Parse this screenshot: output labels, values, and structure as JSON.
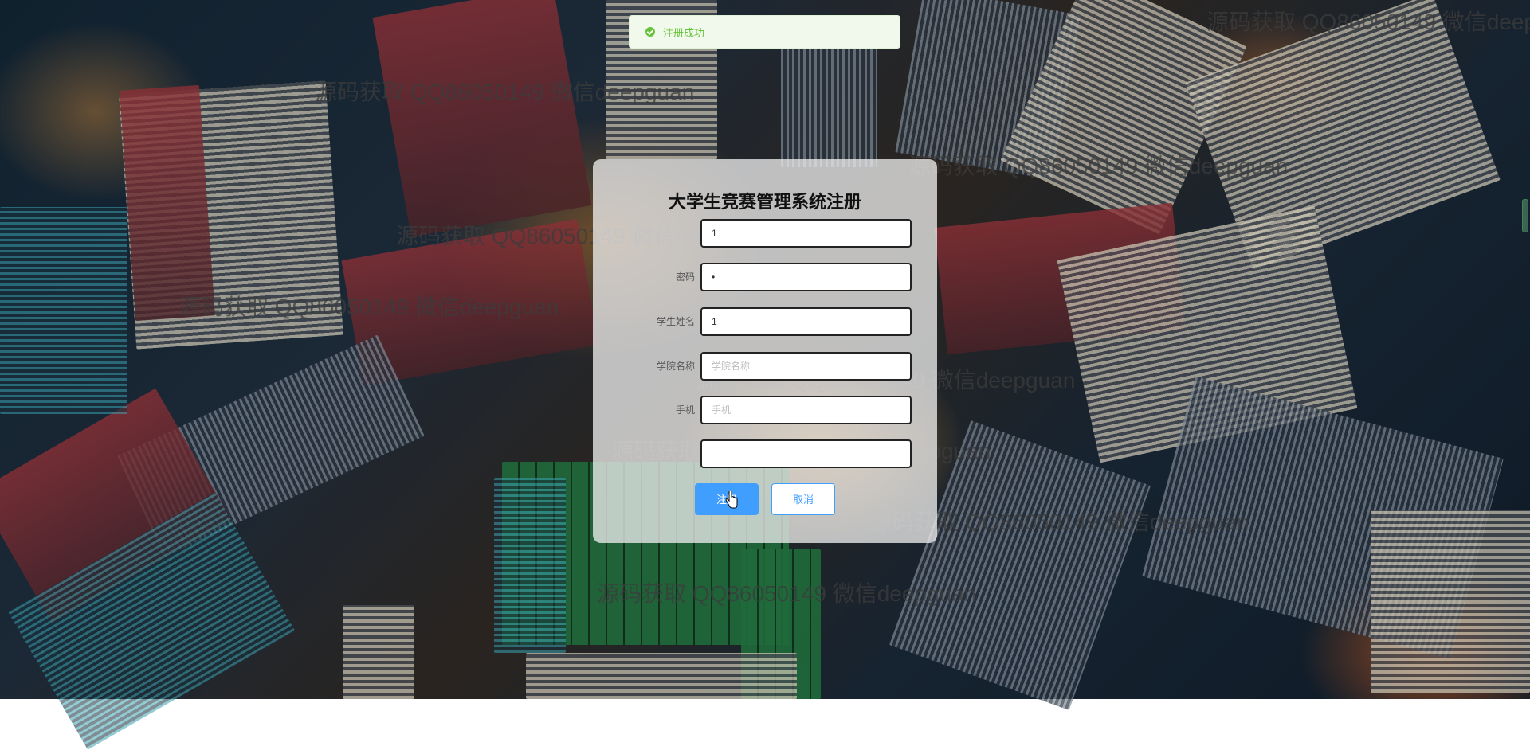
{
  "toast": {
    "text": "注册成功",
    "icon": "check-circle-icon",
    "color": "#67c23a"
  },
  "form": {
    "title": "大学生竞赛管理系统注册",
    "fields": [
      {
        "label": "",
        "value": "1",
        "placeholder": ""
      },
      {
        "label": "密码",
        "value": "•",
        "placeholder": ""
      },
      {
        "label": "学生姓名",
        "value": "1",
        "placeholder": ""
      },
      {
        "label": "学院名称",
        "value": "",
        "placeholder": "学院名称"
      },
      {
        "label": "手机",
        "value": "",
        "placeholder": "手机"
      },
      {
        "label": "",
        "value": "",
        "placeholder": ""
      }
    ],
    "register_label": "注册",
    "cancel_label": "取消",
    "accent": "#409eff"
  },
  "watermark": {
    "text": "源码获取 QQ86050149 微信deepguan"
  }
}
